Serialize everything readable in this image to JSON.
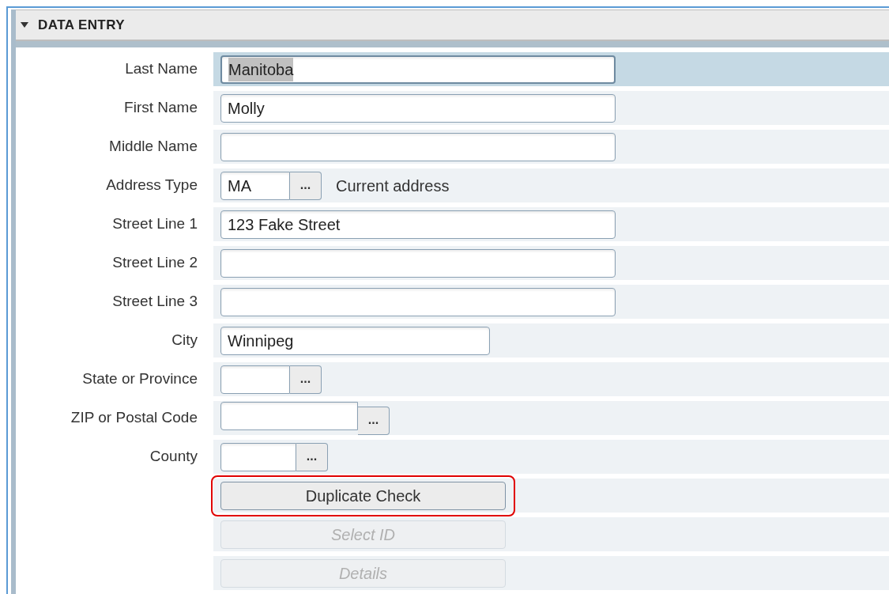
{
  "panel": {
    "title": "DATA ENTRY",
    "expanded": true
  },
  "rows": [
    {
      "kind": "text",
      "label": "Last Name",
      "value": "Manitoba",
      "selected": true
    },
    {
      "kind": "text",
      "label": "First Name",
      "value": "Molly",
      "selected": false
    },
    {
      "kind": "text",
      "label": "Middle Name",
      "selected": false
    },
    {
      "kind": "lookup",
      "label": "Address Type",
      "value": "MA",
      "button": "...",
      "description": "Current address",
      "selected": false
    },
    {
      "kind": "text",
      "label": "Street Line 1",
      "value": "123 Fake Street",
      "selected": false
    },
    {
      "kind": "text",
      "label": "Street Line 2",
      "selected": false
    },
    {
      "kind": "text",
      "label": "Street Line 3",
      "selected": false
    },
    {
      "kind": "text",
      "label": "City",
      "value": "Winnipeg",
      "selected": false
    },
    {
      "kind": "lookup",
      "label": "State or Province",
      "button": "...",
      "selected": false
    },
    {
      "kind": "lookup",
      "label": "ZIP or Postal Code",
      "button": "...",
      "selected": false
    },
    {
      "kind": "lookup",
      "label": "County",
      "button": "...",
      "selected": false
    },
    {
      "kind": "button",
      "label": "Duplicate Check",
      "disabled": false,
      "highlighted": true,
      "selected": false
    },
    {
      "kind": "button",
      "label": "Select ID",
      "disabled": true,
      "highlighted": false,
      "selected": false
    },
    {
      "kind": "button",
      "label": "Details",
      "disabled": true,
      "highlighted": false,
      "selected": false
    }
  ]
}
